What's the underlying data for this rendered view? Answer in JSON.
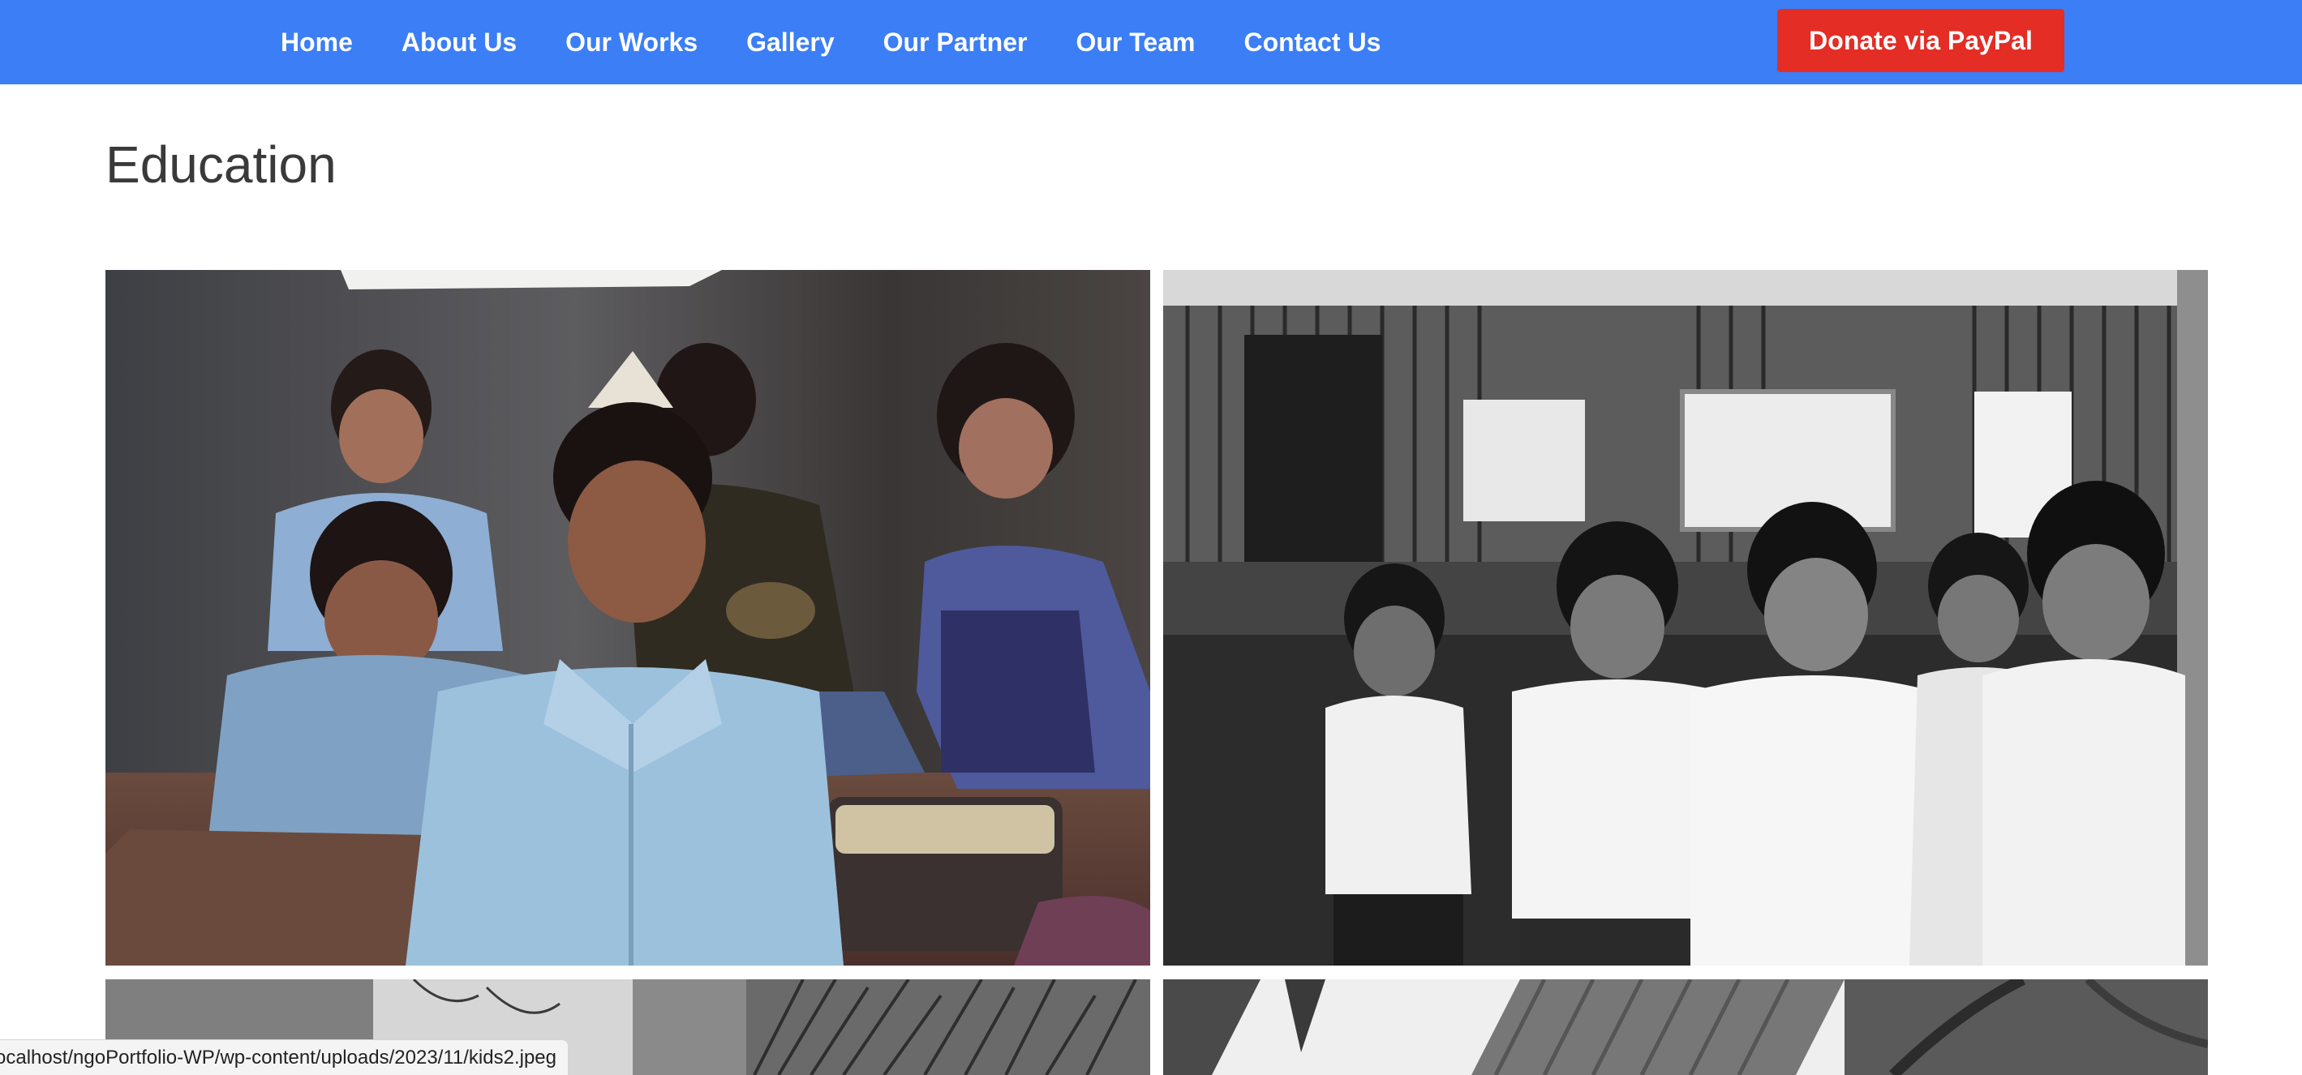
{
  "nav": {
    "items": [
      {
        "label": "Home"
      },
      {
        "label": "About Us"
      },
      {
        "label": "Our Works"
      },
      {
        "label": "Gallery"
      },
      {
        "label": "Our Partner"
      },
      {
        "label": "Our Team"
      },
      {
        "label": "Contact Us"
      }
    ],
    "donate_label": "Donate via PayPal"
  },
  "page": {
    "title": "Education"
  },
  "gallery": {
    "images": [
      {
        "name": "children-classroom-photo"
      },
      {
        "name": "children-uniform-bw-photo"
      },
      {
        "name": "palm-leaves-bw-photo"
      },
      {
        "name": "roof-sheet-bw-photo"
      }
    ]
  },
  "status_bar": {
    "url": "ocalhost/ngoPortfolio-WP/wp-content/uploads/2023/11/kids2.jpeg"
  },
  "colors": {
    "nav_bg": "#3b7ef6",
    "donate_bg": "#e32d25",
    "title_text": "#3a3a3a"
  }
}
